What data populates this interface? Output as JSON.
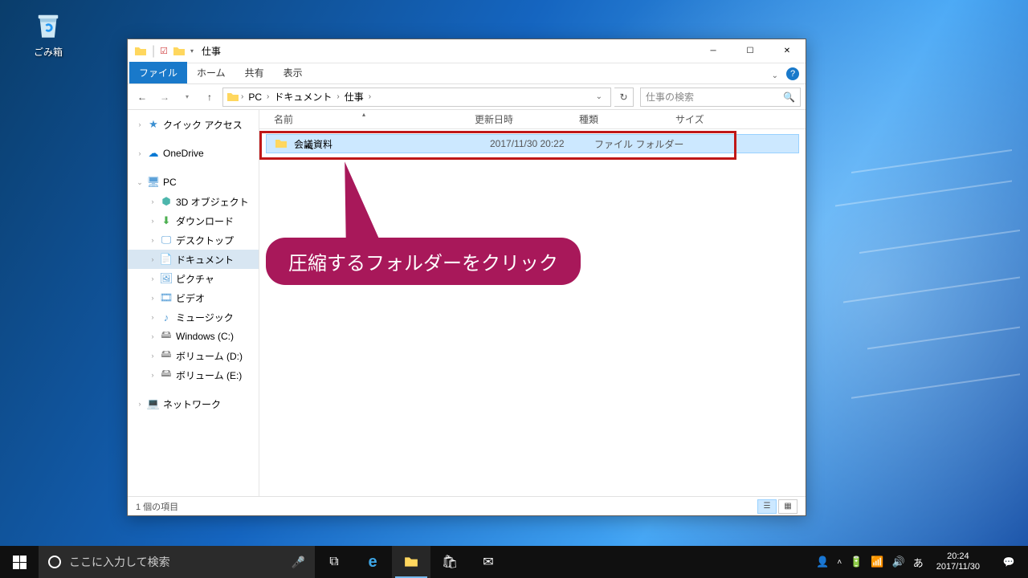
{
  "desktop": {
    "recycle_bin": "ごみ箱"
  },
  "window": {
    "title": "仕事",
    "tabs": {
      "file": "ファイル",
      "home": "ホーム",
      "share": "共有",
      "view": "表示"
    },
    "breadcrumb": {
      "pc": "PC",
      "documents": "ドキュメント",
      "folder": "仕事"
    },
    "search_placeholder": "仕事の検索",
    "nav": {
      "quick_access": "クイック アクセス",
      "onedrive": "OneDrive",
      "pc": "PC",
      "objects_3d": "3D オブジェクト",
      "downloads": "ダウンロード",
      "desktop": "デスクトップ",
      "documents": "ドキュメント",
      "pictures": "ピクチャ",
      "videos": "ビデオ",
      "music": "ミュージック",
      "drive_c": "Windows (C:)",
      "drive_d": "ボリューム (D:)",
      "drive_e": "ボリューム (E:)",
      "network": "ネットワーク"
    },
    "columns": {
      "name": "名前",
      "date": "更新日時",
      "type": "種類",
      "size": "サイズ"
    },
    "files": [
      {
        "name": "会議資料",
        "date": "2017/11/30 20:22",
        "type": "ファイル フォルダー"
      }
    ],
    "status": "1 個の項目"
  },
  "annotation": {
    "text": "圧縮するフォルダーをクリック"
  },
  "taskbar": {
    "search_placeholder": "ここに入力して検索",
    "ime": "あ",
    "time": "20:24",
    "date": "2017/11/30"
  }
}
